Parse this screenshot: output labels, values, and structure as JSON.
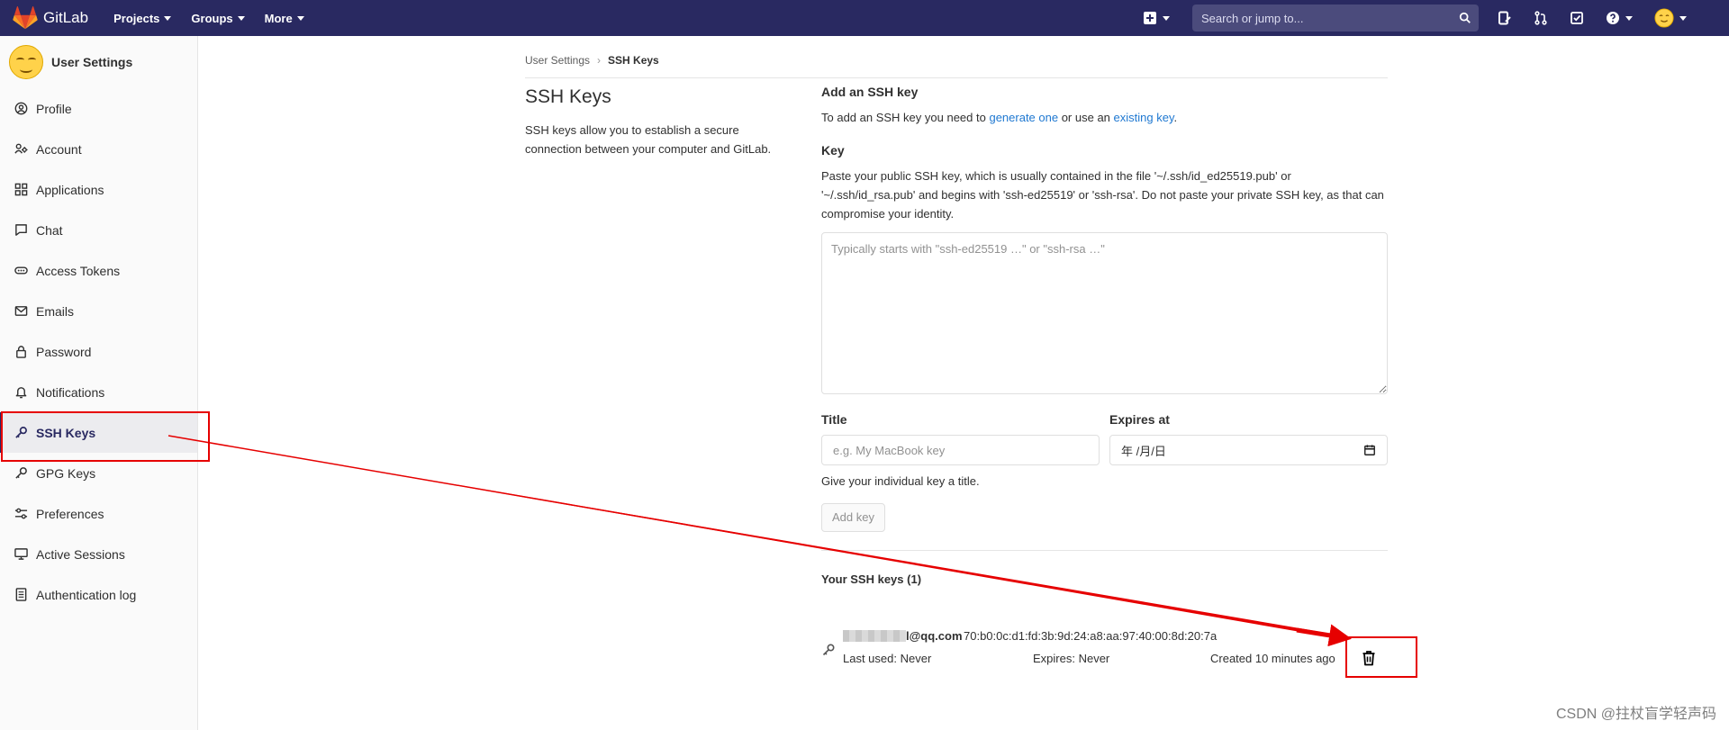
{
  "navbar": {
    "brand": "GitLab",
    "menu": [
      {
        "label": "Projects"
      },
      {
        "label": "Groups"
      },
      {
        "label": "More"
      }
    ],
    "search_placeholder": "Search or jump to...",
    "icons": [
      "plus-square-icon",
      "search-icon",
      "issues-icon",
      "merge-request-icon",
      "todo-icon",
      "help-icon",
      "avatar"
    ]
  },
  "sidebar": {
    "title": "User Settings",
    "items": [
      {
        "label": "Profile",
        "icon": "profile-icon"
      },
      {
        "label": "Account",
        "icon": "account-icon"
      },
      {
        "label": "Applications",
        "icon": "applications-icon"
      },
      {
        "label": "Chat",
        "icon": "chat-icon"
      },
      {
        "label": "Access Tokens",
        "icon": "token-icon"
      },
      {
        "label": "Emails",
        "icon": "mail-icon"
      },
      {
        "label": "Password",
        "icon": "lock-icon"
      },
      {
        "label": "Notifications",
        "icon": "bell-icon"
      },
      {
        "label": "SSH Keys",
        "icon": "key-icon",
        "active": true
      },
      {
        "label": "GPG Keys",
        "icon": "key-icon"
      },
      {
        "label": "Preferences",
        "icon": "sliders-icon"
      },
      {
        "label": "Active Sessions",
        "icon": "monitor-icon"
      },
      {
        "label": "Authentication log",
        "icon": "log-icon"
      }
    ]
  },
  "breadcrumb": {
    "parent": "User Settings",
    "current": "SSH Keys"
  },
  "intro": {
    "title": "SSH Keys",
    "description": "SSH keys allow you to establish a secure connection between your computer and GitLab."
  },
  "add_key": {
    "section_title": "Add an SSH key",
    "help_prefix": "To add an SSH key you need to ",
    "help_link1": "generate one",
    "help_mid": " or use an ",
    "help_link2": "existing key",
    "help_suffix": ".",
    "key_label": "Key",
    "key_description": "Paste your public SSH key, which is usually contained in the file '~/.ssh/id_ed25519.pub' or '~/.ssh/id_rsa.pub' and begins with 'ssh-ed25519' or 'ssh-rsa'. Do not paste your private SSH key, as that can compromise your identity.",
    "key_placeholder": "Typically starts with \"ssh-ed25519 …\" or \"ssh-rsa …\"",
    "title_label": "Title",
    "title_placeholder": "e.g. My MacBook key",
    "expires_label": "Expires at",
    "expires_value": "年 /月/日",
    "title_help": "Give your individual key a title.",
    "add_button": "Add key"
  },
  "keys": {
    "heading": "Your SSH keys (1)",
    "list": [
      {
        "email": "l@qq.com",
        "fingerprint": "70:b0:0c:d1:fd:3b:9d:24:a8:aa:97:40:00:8d:20:7a",
        "last_used": "Last used: Never",
        "expires": "Expires: Never",
        "created": "Created 10 minutes ago"
      }
    ]
  },
  "colors": {
    "navbar": "#292961",
    "link": "#1f78d1",
    "annotation": "#e60000"
  },
  "watermark": "CSDN @拄杖盲学轻声码"
}
